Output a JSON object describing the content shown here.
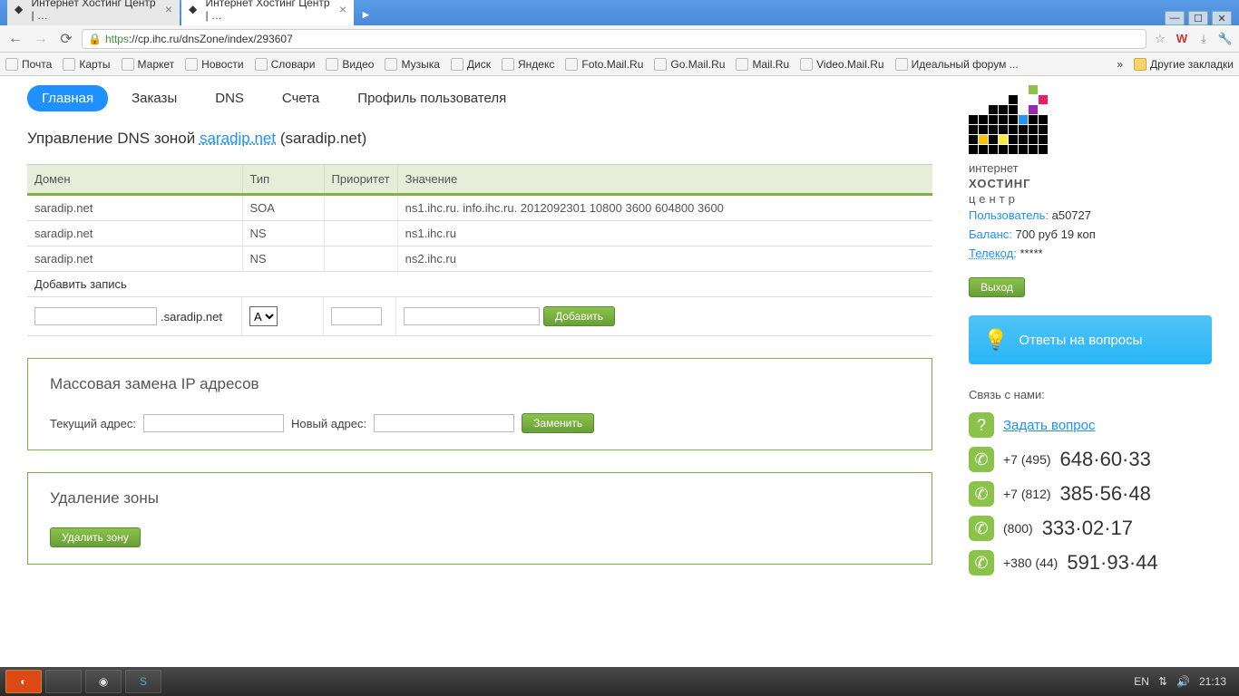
{
  "browser": {
    "tabs": [
      {
        "title": "Интернет Хостинг Центр | …"
      },
      {
        "title": "Интернет Хостинг Центр | …"
      }
    ],
    "url_prefix": "https",
    "url_rest": "://cp.ihc.ru/dnsZone/index/293607",
    "bookmarks": [
      "Почта",
      "Карты",
      "Маркет",
      "Новости",
      "Словари",
      "Видео",
      "Музыка",
      "Диск",
      "Яндекс",
      "Foto.Mail.Ru",
      "Go.Mail.Ru",
      "Mail.Ru",
      "Video.Mail.Ru",
      "Идеальный форум ..."
    ],
    "other_bookmarks": "Другие закладки"
  },
  "nav": {
    "items": [
      "Главная",
      "Заказы",
      "DNS",
      "Счета",
      "Профиль пользователя"
    ]
  },
  "page_title": {
    "prefix": "Управление DNS зоной ",
    "link": "saradip.net",
    "suffix": " (saradip.net)"
  },
  "table": {
    "headers": [
      "Домен",
      "Тип",
      "Приоритет",
      "Значение"
    ],
    "rows": [
      {
        "domain": "saradip.net",
        "type": "SOA",
        "prio": "",
        "value": "ns1.ihc.ru. info.ihc.ru. 2012092301 10800 3600 604800 3600"
      },
      {
        "domain": "saradip.net",
        "type": "NS",
        "prio": "",
        "value": "ns1.ihc.ru"
      },
      {
        "domain": "saradip.net",
        "type": "NS",
        "prio": "",
        "value": "ns2.ihc.ru"
      }
    ],
    "add_caption": "Добавить запись",
    "suffix": ".saradip.net",
    "type_selected": "A",
    "add_button": "Добавить"
  },
  "mass": {
    "title": "Массовая замена IP адресов",
    "current_label": "Текущий адрес:",
    "new_label": "Новый адрес:",
    "button": "Заменить"
  },
  "delete": {
    "title": "Удаление зоны",
    "button": "Удалить зону"
  },
  "sidebar": {
    "logo_lines": [
      "интернет",
      "ХОСТИНГ",
      "центр"
    ],
    "user_label": "Пользователь:",
    "user_value": "a50727",
    "balance_label": "Баланс:",
    "balance_value": "700 руб 19 коп",
    "telecode_label": "Телекод:",
    "telecode_value": "*****",
    "logout": "Выход",
    "faq": "Ответы на вопросы",
    "contact_header": "Связь с нами:",
    "ask_link": "Задать вопрос",
    "phones": [
      {
        "code": "+7 (495)",
        "num": "648·60·33"
      },
      {
        "code": "+7 (812)",
        "num": "385·56·48"
      },
      {
        "code": "(800)",
        "num": "333·02·17"
      },
      {
        "code": "+380 (44)",
        "num": "591·93·44"
      }
    ]
  },
  "taskbar": {
    "lang": "EN",
    "time": "21:13"
  }
}
